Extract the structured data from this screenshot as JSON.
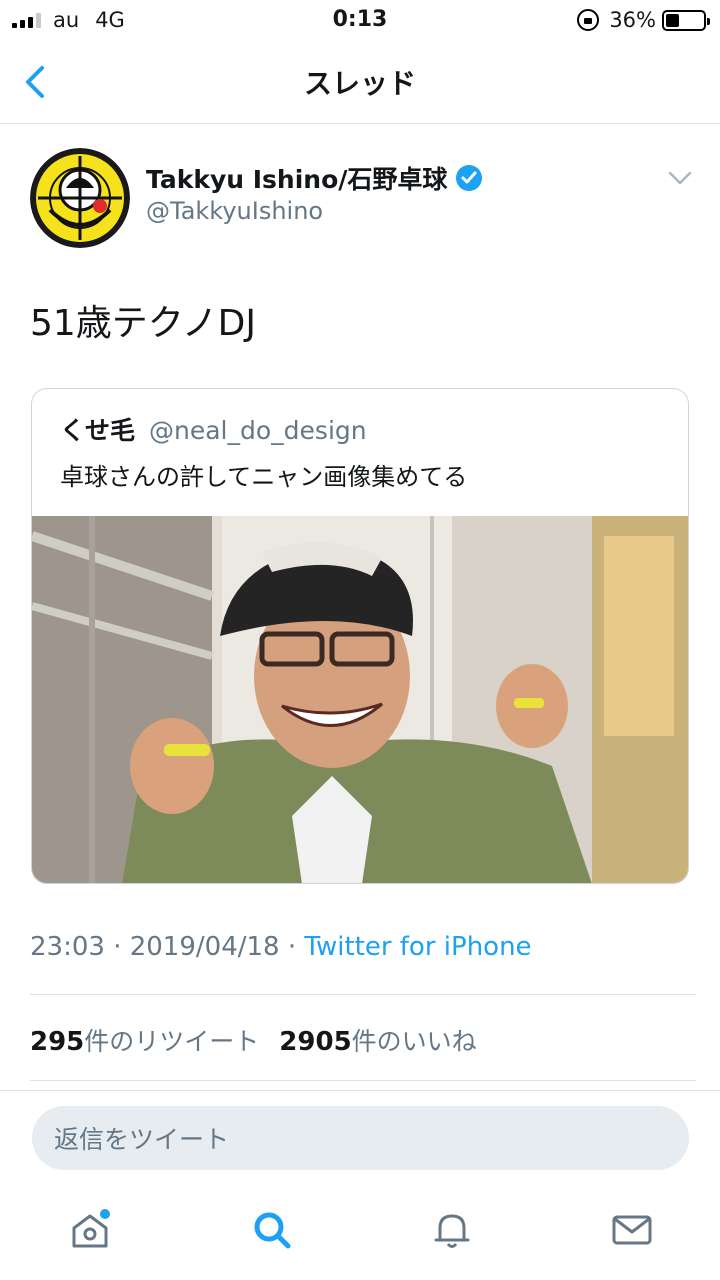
{
  "status_bar": {
    "carrier": "au",
    "network": "4G",
    "time": "0:13",
    "battery": "36%",
    "battery_level": 0.36
  },
  "nav": {
    "title": "スレッド",
    "back_icon": "chevron-left-icon"
  },
  "tweet": {
    "author_name": "Takkyu Ishino/石野卓球",
    "author_handle": "@TakkyuIshino",
    "verified_icon": "verified-badge-icon",
    "text": "51歳テクノDJ",
    "quote": {
      "name": "くせ毛",
      "handle": "@neal_do_design",
      "text": "卓球さんの許してニャン画像集めてる"
    },
    "timestamp": "23:03 · 2019/04/18 · ",
    "source": "Twitter for iPhone",
    "retweet_count": "295",
    "retweet_label": "件のリツイート",
    "like_count": "2905",
    "like_label": "件のいいね"
  },
  "reply": {
    "placeholder": "返信をツイート"
  },
  "tabs": [
    {
      "icon": "home-icon",
      "active": false,
      "notification_dot": true
    },
    {
      "icon": "search-icon",
      "active": true
    },
    {
      "icon": "bell-icon",
      "active": false
    },
    {
      "icon": "mail-icon",
      "active": false
    }
  ],
  "colors": {
    "accent": "#1da1f2",
    "secondary_text": "#657786",
    "divider": "#dce1e5"
  }
}
